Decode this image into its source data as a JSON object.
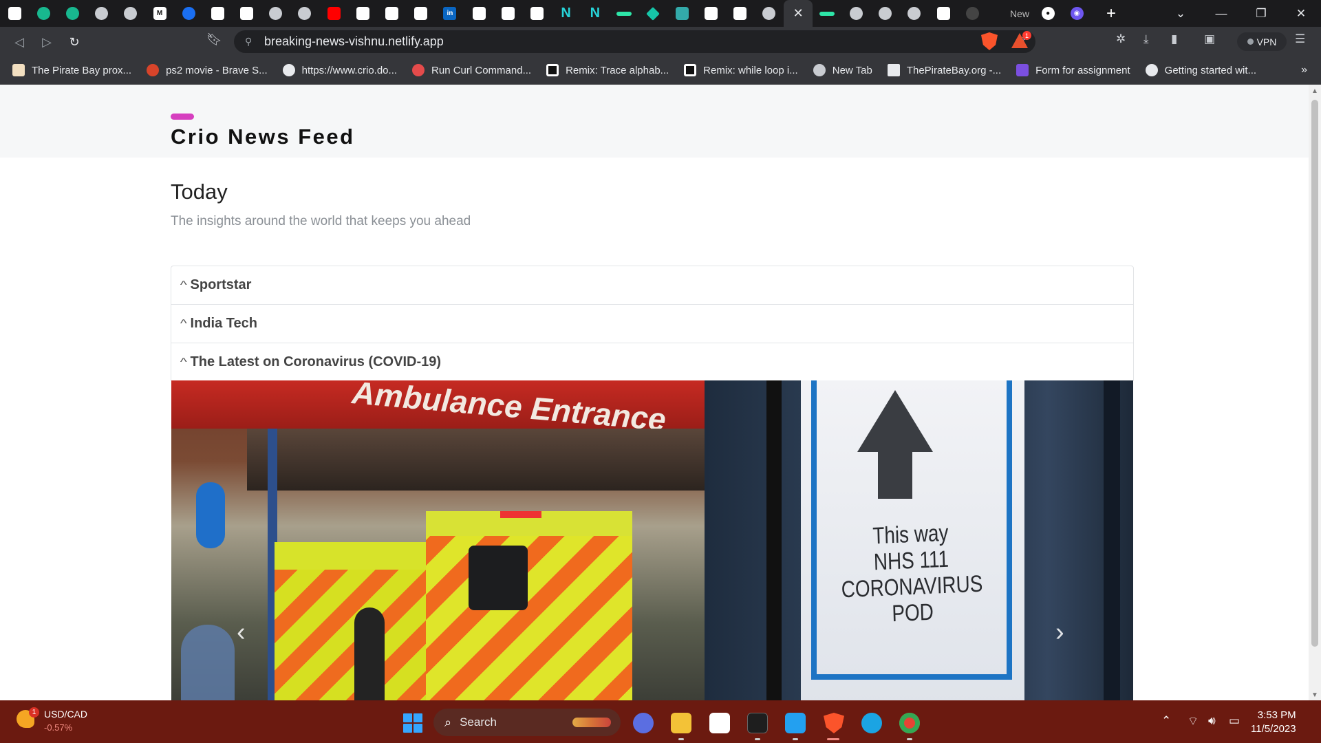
{
  "browser": {
    "tabs": [
      {
        "icon": "shield-favicon"
      },
      {
        "icon": "chatgpt-favicon"
      },
      {
        "icon": "chatgpt-favicon"
      },
      {
        "icon": "globe-icon"
      },
      {
        "icon": "globe-icon"
      },
      {
        "icon": "medium-favicon",
        "glyph": "M"
      },
      {
        "icon": "blue-circle-favicon"
      },
      {
        "icon": "shield-favicon"
      },
      {
        "icon": "drive-favicon"
      },
      {
        "icon": "globe-icon"
      },
      {
        "icon": "globe-icon"
      },
      {
        "icon": "youtube-favicon"
      },
      {
        "icon": "b-favicon"
      },
      {
        "icon": "shield-favicon"
      },
      {
        "icon": "shield-favicon"
      },
      {
        "icon": "linkedin-favicon",
        "glyph": "in"
      },
      {
        "icon": "gear-icon"
      },
      {
        "icon": "image-favicon"
      },
      {
        "icon": "download-icon"
      },
      {
        "icon": "n-favicon",
        "glyph": "N"
      },
      {
        "icon": "n-favicon",
        "glyph": "N"
      },
      {
        "icon": "dash-favicon"
      },
      {
        "icon": "diamond-favicon"
      },
      {
        "icon": "react-favicon"
      },
      {
        "icon": "shield-favicon"
      },
      {
        "icon": "shield-favicon"
      },
      {
        "icon": "globe-icon"
      },
      {
        "icon": "close-icon",
        "active": true
      },
      {
        "icon": "dash-favicon"
      },
      {
        "icon": "globe-icon"
      },
      {
        "icon": "globe-icon"
      },
      {
        "icon": "globe-icon"
      },
      {
        "icon": "shield-favicon"
      },
      {
        "icon": "loading-favicon"
      }
    ],
    "partial_tab_label": "New",
    "url": "breaking-news-vishnu.netlify.app",
    "vpn_label": "VPN",
    "rewards_count": "1",
    "bookmarks": [
      {
        "label": "The Pirate Bay prox...",
        "icon": "pirate-bay-icon"
      },
      {
        "label": "ps2 movie - Brave S...",
        "icon": "brave-icon"
      },
      {
        "label": "https://www.crio.do...",
        "icon": "crio-icon"
      },
      {
        "label": "Run Curl Command...",
        "icon": "curl-icon"
      },
      {
        "label": "Remix: Trace alphab...",
        "icon": "remix-icon"
      },
      {
        "label": "Remix: while loop i...",
        "icon": "remix-icon"
      },
      {
        "label": "New Tab",
        "icon": "globe-icon"
      },
      {
        "label": "ThePirateBay.org -...",
        "icon": "tpb-icon"
      },
      {
        "label": "Form for assignment",
        "icon": "form-icon"
      },
      {
        "label": "Getting started wit...",
        "icon": "shield-icon"
      }
    ],
    "bookmarks_more": "»"
  },
  "page": {
    "brand": "Crio News Feed",
    "heading": "Today",
    "subtitle": "The insights around the world that keeps you ahead",
    "accordion": [
      {
        "title": "Sportstar"
      },
      {
        "title": "India Tech"
      },
      {
        "title": "The Latest on Coronavirus (COVID-19)"
      }
    ],
    "carousel": {
      "image_text_sign": "Ambulance Entrance",
      "image_text_card": "This way\nNHS 111\nCORONAVIRUS POD",
      "prev": "‹",
      "next": "›"
    }
  },
  "taskbar": {
    "widget_title": "USD/CAD",
    "widget_value": "-0.57%",
    "widget_badge": "1",
    "search_label": "Search",
    "time": "3:53 PM",
    "date": "11/5/2023"
  }
}
